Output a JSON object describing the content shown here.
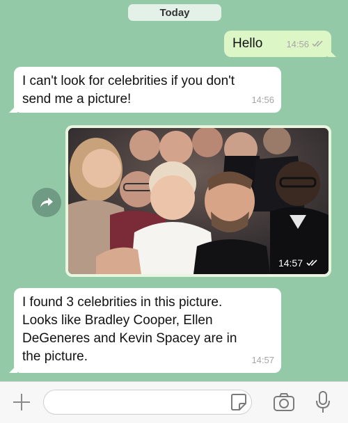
{
  "chat": {
    "date_label": "Today",
    "messages": [
      {
        "direction": "outgoing",
        "text": "Hello",
        "time": "14:56"
      },
      {
        "direction": "incoming",
        "line1": "I can't look for celebrities if you don't",
        "line2": "send me a picture!",
        "time": "14:56"
      },
      {
        "direction": "outgoing",
        "type": "photo",
        "time": "14:57"
      },
      {
        "direction": "incoming",
        "line1": "I found 3 celebrities in this picture.",
        "line2": "Looks like Bradley Cooper, Ellen",
        "line3": "DeGeneres and Kevin Spacey are in",
        "line4": "the picture.",
        "time": "14:57"
      }
    ]
  },
  "input_bar": {
    "placeholder": "",
    "icons": [
      "plus-icon",
      "sticker-icon",
      "camera-icon",
      "microphone-icon"
    ]
  },
  "colors": {
    "chat_background": "#93c9a7",
    "outgoing_bubble": "#dcf7c5",
    "incoming_bubble": "#ffffff",
    "read_ticks": "#9aa0a6"
  }
}
